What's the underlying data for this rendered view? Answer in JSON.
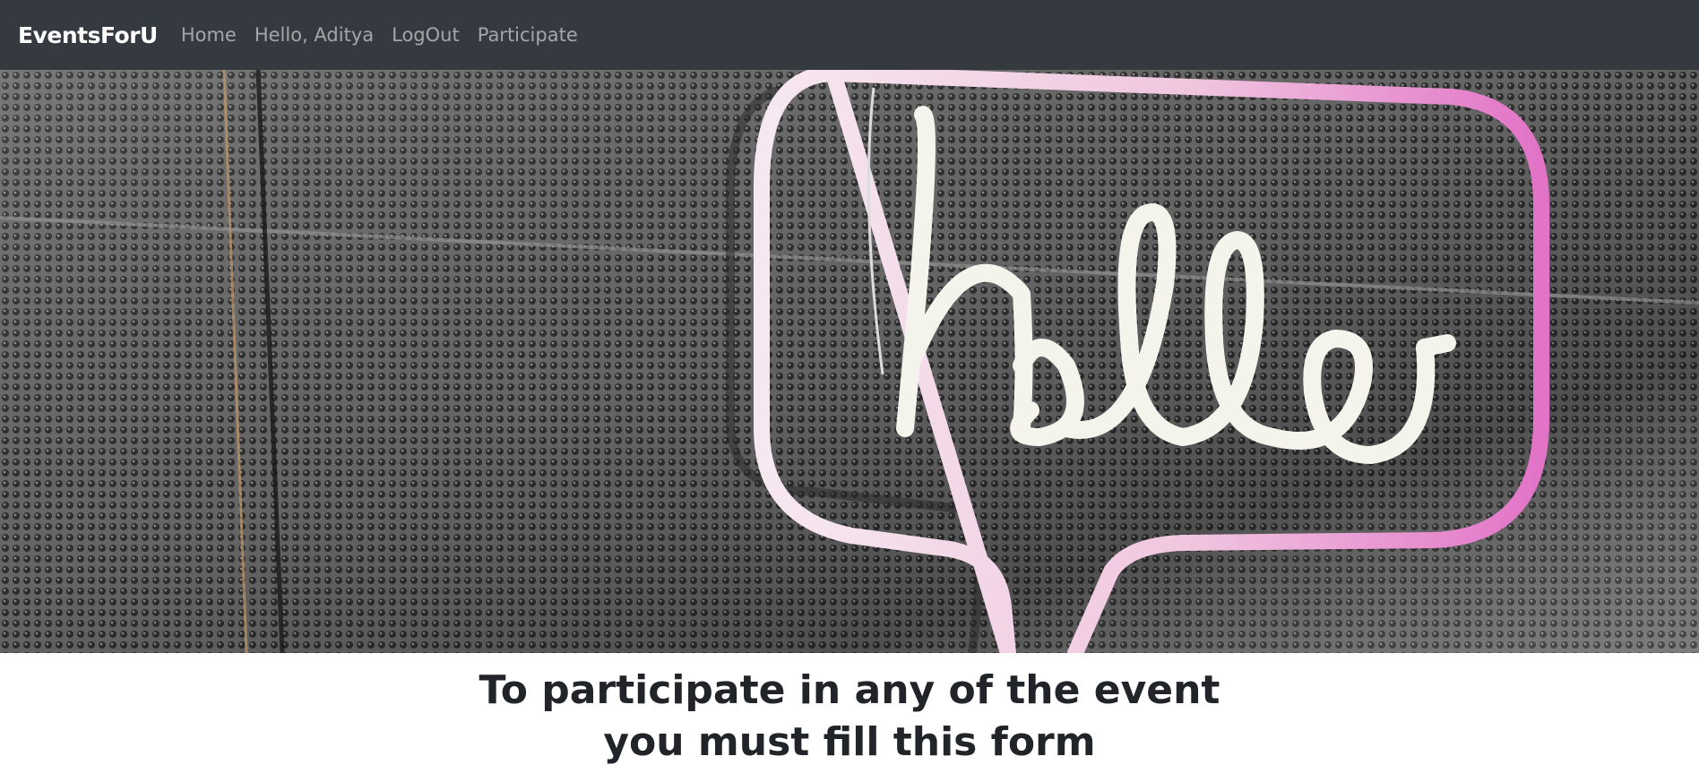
{
  "navbar": {
    "brand": "EventsForU",
    "links": [
      {
        "label": "Home"
      },
      {
        "label": "Hello, Aditya"
      },
      {
        "label": "LogOut"
      },
      {
        "label": "Participate"
      }
    ],
    "background": "#343a40"
  },
  "hero": {
    "neon_sign_text": "hello",
    "neon_colors": {
      "tube": "#f4f4ec",
      "outline_pink": "#e273c7"
    },
    "wall_color": "#5a5a5a"
  },
  "main": {
    "heading_line1": "To participate in any of the event",
    "heading_line2": "you must fill this form"
  }
}
